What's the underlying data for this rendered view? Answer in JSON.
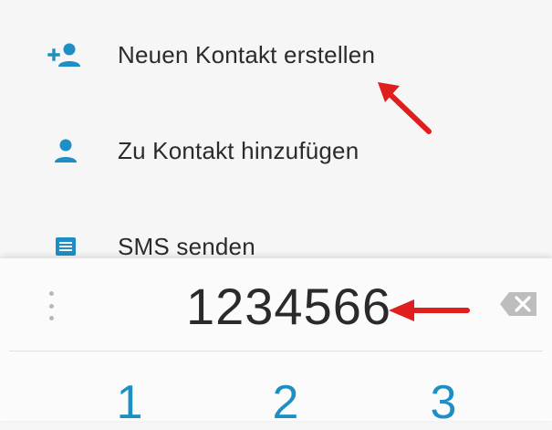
{
  "menu": {
    "items": [
      {
        "label": "Neuen Kontakt erstellen",
        "icon": "add-person-icon"
      },
      {
        "label": "Zu Kontakt hinzufügen",
        "icon": "person-icon"
      },
      {
        "label": "SMS senden",
        "icon": "message-icon"
      }
    ]
  },
  "dialpad": {
    "number": "1234566",
    "keys": [
      "1",
      "2",
      "3"
    ]
  },
  "colors": {
    "accent": "#1d8fc4",
    "annotation": "#e01e1e"
  }
}
